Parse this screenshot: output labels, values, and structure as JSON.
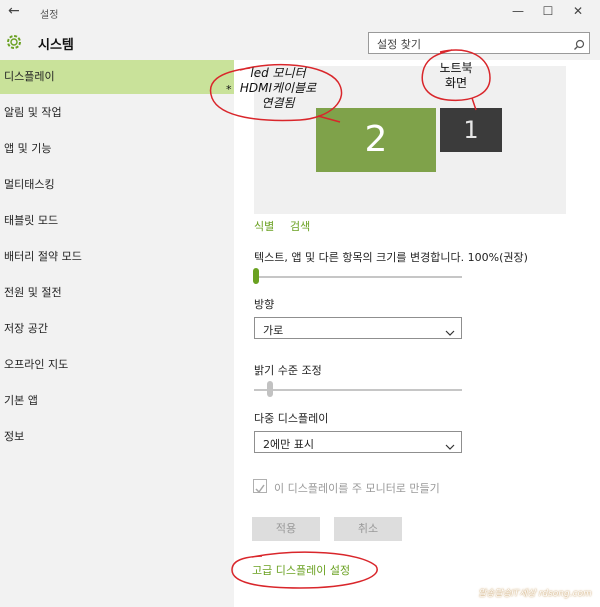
{
  "window": {
    "title": "설정",
    "back_icon": "back-arrow-icon",
    "minimize": "—",
    "maximize": "☐",
    "close": "✕"
  },
  "header": {
    "app_title": "시스템",
    "search_placeholder": "설정 찾기"
  },
  "sidebar": {
    "items": [
      {
        "label": "디스플레이",
        "active": true
      },
      {
        "label": "알림 및 작업"
      },
      {
        "label": "앱 및 기능"
      },
      {
        "label": "멀티태스킹"
      },
      {
        "label": "태블릿 모드"
      },
      {
        "label": "배터리 절약 모드"
      },
      {
        "label": "전원 및 절전"
      },
      {
        "label": "저장 공간"
      },
      {
        "label": "오프라인 지도"
      },
      {
        "label": "기본 앱"
      },
      {
        "label": "정보"
      }
    ]
  },
  "display": {
    "monitor_2_number": "2",
    "monitor_1_number": "1",
    "identify_link": "식별",
    "detect_link": "검색",
    "scale_label": "텍스트, 앱 및 다른 항목의 크기를 변경합니다. 100%(권장)",
    "scale_level": 0,
    "orientation_label": "방향",
    "orientation_value": "가로",
    "brightness_label": "밝기 수준 조정",
    "brightness_level": 0.08,
    "multi_display_label": "다중 디스플레이",
    "multi_display_value": "2에만 표시",
    "main_monitor_checkbox_label": "이 디스플레이를 주 모니터로 만들기",
    "main_monitor_checked": true,
    "apply_button": "적용",
    "cancel_button": "취소",
    "advanced_link": "고급 디스플레이 설정"
  },
  "annotations": {
    "led_line1": "led 모니터",
    "led_line2": "HDMI케이블로",
    "led_line3": "연결됨",
    "led_marker": "*",
    "notebook_line1": "노트북",
    "notebook_line2": "화면",
    "watermark": "알송달송IT세상 rdsong.com"
  },
  "colors": {
    "accent": "#6aa121",
    "active_nav": "#c9e29a",
    "monitor_2": "#7fa24a",
    "monitor_1": "#3b3b3b",
    "annotation_ring": "#d9262b"
  }
}
